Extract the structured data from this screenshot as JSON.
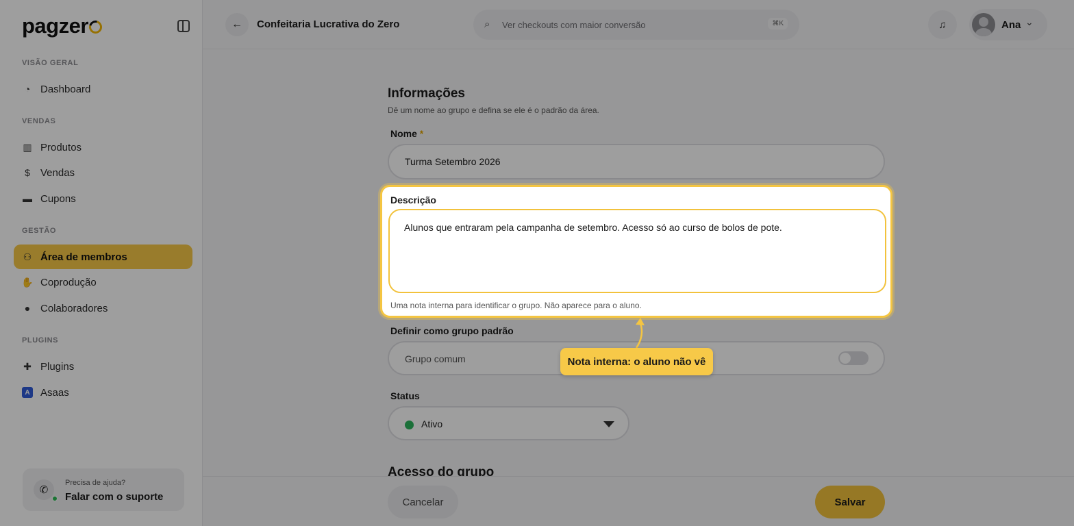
{
  "app": {
    "logo_text": "pagzer"
  },
  "sidebar": {
    "sections": [
      {
        "label": "VISÃO GERAL"
      },
      {
        "label": "VENDAS"
      },
      {
        "label": "GESTÃO"
      },
      {
        "label": "PLUGINS"
      }
    ],
    "items": [
      {
        "label": "Dashboard",
        "icon": "dashboard-icon",
        "active": false
      },
      {
        "label": "Produtos",
        "icon": "products-icon",
        "active": false
      },
      {
        "label": "Vendas",
        "icon": "sales-icon",
        "active": false
      },
      {
        "label": "Cupons",
        "icon": "coupon-icon",
        "active": false
      },
      {
        "label": "Área de membros",
        "icon": "members-icon",
        "active": true
      },
      {
        "label": "Coprodução",
        "icon": "handshake-icon",
        "active": false
      },
      {
        "label": "Colaboradores",
        "icon": "user-icon",
        "active": false
      },
      {
        "label": "Plugins",
        "icon": "puzzle-icon",
        "active": false
      },
      {
        "label": "Asaas",
        "icon": "asaas-icon",
        "active": false
      }
    ],
    "help": {
      "small": "Precisa de ajuda?",
      "big": "Falar com o suporte"
    }
  },
  "header": {
    "title": "Confeitaria Lucrativa do Zero",
    "search_placeholder": "Ver checkouts com maior conversão",
    "search_shortcut": "⌘K",
    "user_name": "Ana"
  },
  "form": {
    "title": "Informações",
    "subtitle": "Dê um nome ao grupo e defina se ele é o padrão da área.",
    "name_label": "Nome",
    "name_required": "*",
    "name_value": "Turma Setembro 2026",
    "description_label": "Descrição",
    "description_value": "Alunos que entraram pela campanha de setembro. Acesso só ao curso de bolos de pote.",
    "description_help": "Uma nota interna para identificar o grupo. Não aparece para o aluno.",
    "default_label": "Definir como grupo padrão",
    "default_value": "Grupo comum",
    "default_enabled": false,
    "status_label": "Status",
    "status_value": "Ativo",
    "status_color": "#2db55d",
    "section2_title": "Acesso do grupo"
  },
  "footer": {
    "cancel_label": "Cancelar",
    "save_label": "Salvar"
  },
  "tooltip": {
    "text": "Nota interna: o aluno não vê"
  },
  "colors": {
    "accent": "#f7c948",
    "highlight_border": "#f4c542"
  }
}
